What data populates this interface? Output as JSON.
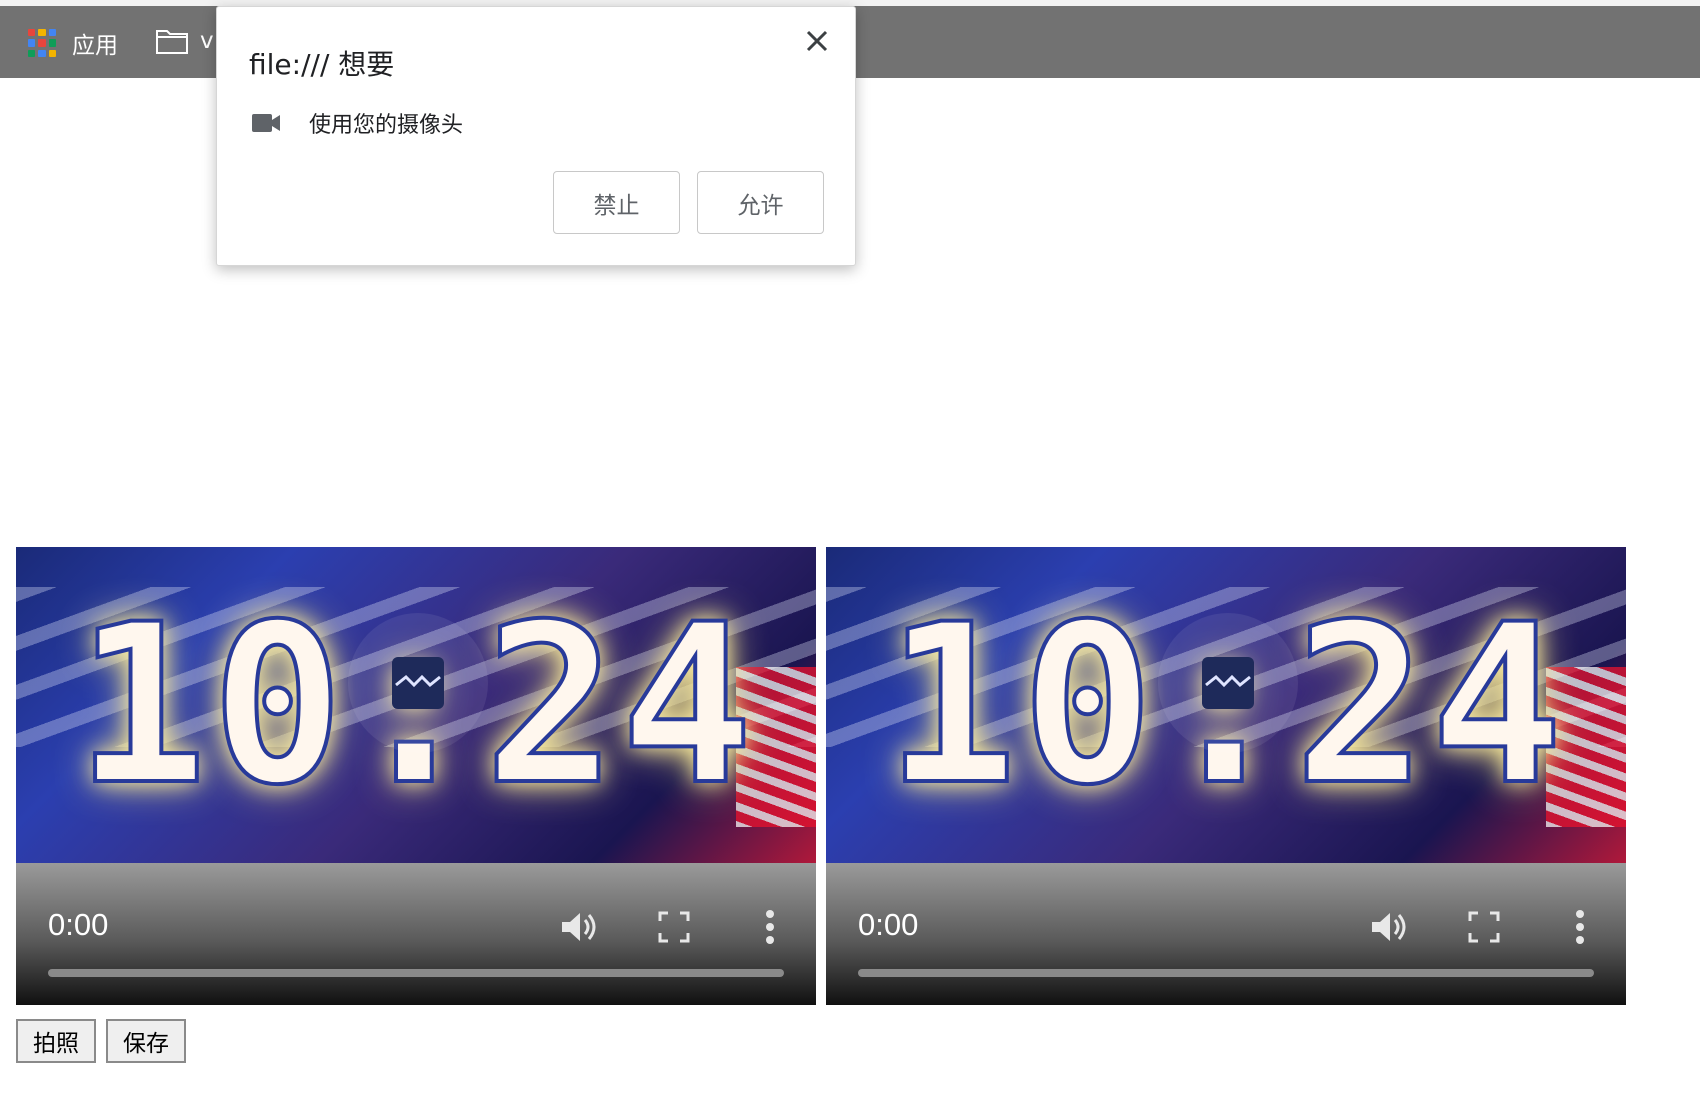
{
  "bookmarks": {
    "apps_label": "应用",
    "folder_label": "v"
  },
  "permission_dialog": {
    "title": "file:/// 想要",
    "permission_text": "使用您的摄像头",
    "block_label": "禁止",
    "allow_label": "允许"
  },
  "videos": [
    {
      "frame_text": "10:24",
      "time": "0:00",
      "progress": 0
    },
    {
      "frame_text": "10:24",
      "time": "0:00",
      "progress": 0
    }
  ],
  "actions": {
    "capture_label": "拍照",
    "save_label": "保存"
  },
  "colors": {
    "bookmarks_bar": "#727272",
    "dialog_bg": "#ffffff",
    "button_border": "#8a8a8a"
  },
  "icons": [
    "apps-grid-icon",
    "folder-icon",
    "close-icon",
    "camera-icon",
    "broken-image-icon",
    "volume-icon",
    "fullscreen-icon",
    "more-vert-icon"
  ]
}
